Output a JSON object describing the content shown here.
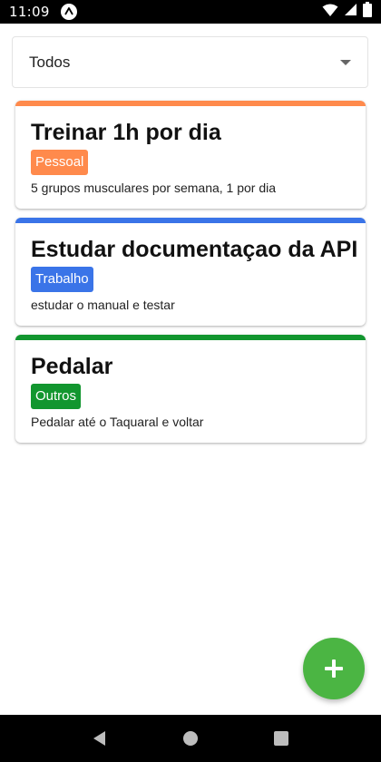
{
  "status_bar": {
    "time": "11:09",
    "icons": [
      "app-notification-icon",
      "wifi-icon",
      "cell-signal-icon",
      "battery-icon"
    ]
  },
  "filter": {
    "selected": "Todos",
    "icon": "dropdown-arrow-icon"
  },
  "tasks": [
    {
      "title": "Treinar 1h por dia",
      "category": "Pessoal",
      "description": "5 grupos musculares por semana, 1 por dia",
      "color": "#ff8a4c"
    },
    {
      "title": "Estudar documentaçao da API",
      "category": "Trabalho",
      "description": "estudar o manual e testar",
      "color": "#3a74e8"
    },
    {
      "title": "Pedalar",
      "category": "Outros",
      "description": "Pedalar até o Taquaral e voltar",
      "color": "#12962f"
    }
  ],
  "fab": {
    "icon": "plus-icon",
    "color": "#4bb543"
  },
  "nav_bar": {
    "icons": [
      "back-icon",
      "home-icon",
      "recents-icon"
    ]
  }
}
